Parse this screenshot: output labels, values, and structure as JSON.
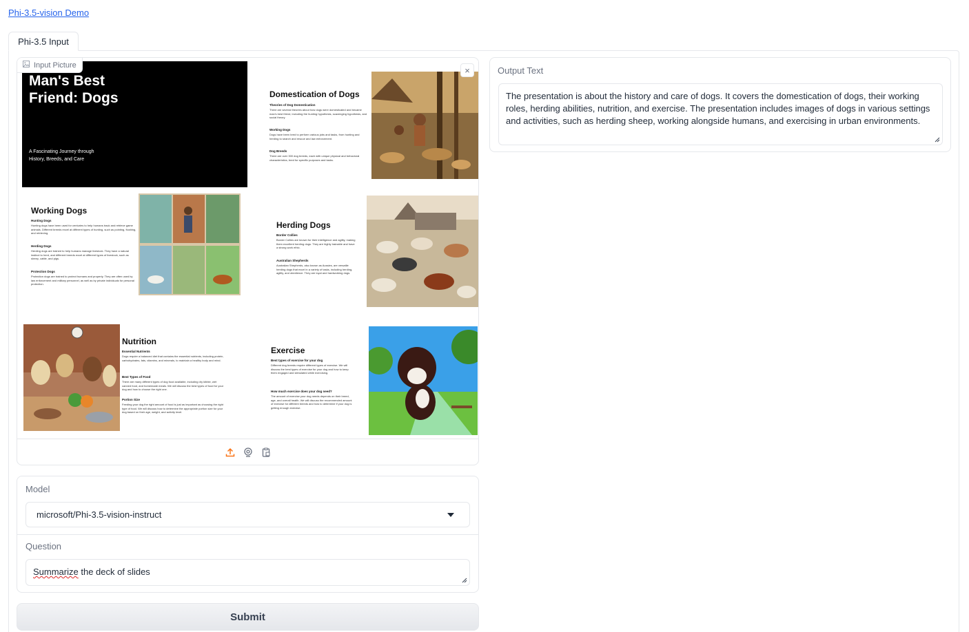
{
  "header": {
    "link_label": "Phi-3.5-vision Demo"
  },
  "tabs": [
    {
      "label": "Phi-3.5 Input",
      "active": true
    }
  ],
  "image_input": {
    "label": "Input Picture",
    "icons": [
      "image-icon",
      "close-icon",
      "upload-icon",
      "webcam-icon",
      "clipboard-icon"
    ],
    "slides": {
      "title_slide": {
        "title_line1": "Man's Best",
        "title_line2": "Friend: Dogs",
        "subtitle_line1": "A Fascinating Journey through",
        "subtitle_line2": "History, Breeds, and Care"
      },
      "domestication": {
        "title": "Domestication of Dogs",
        "h1": "Theories of Dog Domestication",
        "t1": "There are several theories about how dogs were domesticated and became man's best friend, including the hunting hypothesis, scavenging hypothesis, and social theory.",
        "h2": "Working Dogs",
        "t2": "Dogs have been bred to perform various jobs and tasks, from hunting and herding to search and rescue and law enforcement.",
        "h3": "Dog Breeds",
        "t3": "There are over 300 dog breeds, each with unique physical and behavioral characteristics, bred for specific purposes and tasks."
      },
      "working": {
        "title": "Working Dogs",
        "h1": "Hunting Dogs",
        "t1": "Hunting dogs have been used for centuries to help humans track and retrieve game animals. Different breeds excel at different types of hunting, such as pointing, flushing, and retrieving.",
        "h2": "Herding Dogs",
        "t2": "Herding dogs are trained to help humans manage livestock. They have a natural instinct to herd, and different breeds excel at different types of livestock, such as sheep, cattle, and pigs.",
        "h3": "Protection Dogs",
        "t3": "Protection dogs are trained to protect humans and property. They are often used by law enforcement and military personnel, as well as by private individuals for personal protection."
      },
      "herding": {
        "title": "Herding Dogs",
        "h1": "Border Collies",
        "t1": "Border Collies are known for their intelligence and agility, making them excellent herding dogs. They are highly trainable and have a strong work ethic.",
        "h2": "Australian Shepherds",
        "t2": "Australian Shepherds, also known as Aussies, are versatile herding dogs that excel in a variety of tasks, including herding, agility, and obedience. They are loyal and hardworking dogs."
      },
      "nutrition": {
        "title": "Nutrition",
        "h1": "Essential Nutrients",
        "t1": "Dogs require a balanced diet that contains the essential nutrients, including protein, carbohydrates, fats, vitamins, and minerals, to maintain a healthy body and mind.",
        "h2": "Best Types of Food",
        "t2": "There are many different types of dog food available, including dry kibble, wet canned food, and homemade meals. We will discuss the best types of food for your dog and how to choose the right one.",
        "h3": "Portion Size",
        "t3": "Feeding your dog the right amount of food is just as important as choosing the right type of food. We will discuss how to determine the appropriate portion size for your dog based on their age, weight, and activity level."
      },
      "exercise": {
        "title": "Exercise",
        "h1": "Best types of exercise for your dog",
        "t1": "Different dog breeds require different types of exercise. We will discuss the best types of exercise for your dog and how to keep them engaged and stimulated while exercising.",
        "h2": "How much exercise does your dog need?",
        "t2": "The amount of exercise your dog needs depends on their breed, age, and overall health. We will discuss the recommended amount of exercise for different breeds and how to determine if your dog is getting enough exercise."
      }
    }
  },
  "model": {
    "label": "Model",
    "selected": "microsoft/Phi-3.5-vision-instruct"
  },
  "question": {
    "label": "Question",
    "value_first_word": "Summarize",
    "value_rest": " the deck of slides"
  },
  "submit": {
    "label": "Submit"
  },
  "output": {
    "label": "Output Text",
    "text": "The presentation is about the history and care of dogs. It covers the domestication of dogs, their working roles, herding abilities, nutrition, and exercise. The presentation includes images of dogs in various settings and activities, such as herding sheep, working alongside humans, and exercising in urban environments."
  },
  "colors": {
    "link": "#2563eb",
    "accent_icon": "#f97316",
    "border": "#e5e7eb"
  }
}
